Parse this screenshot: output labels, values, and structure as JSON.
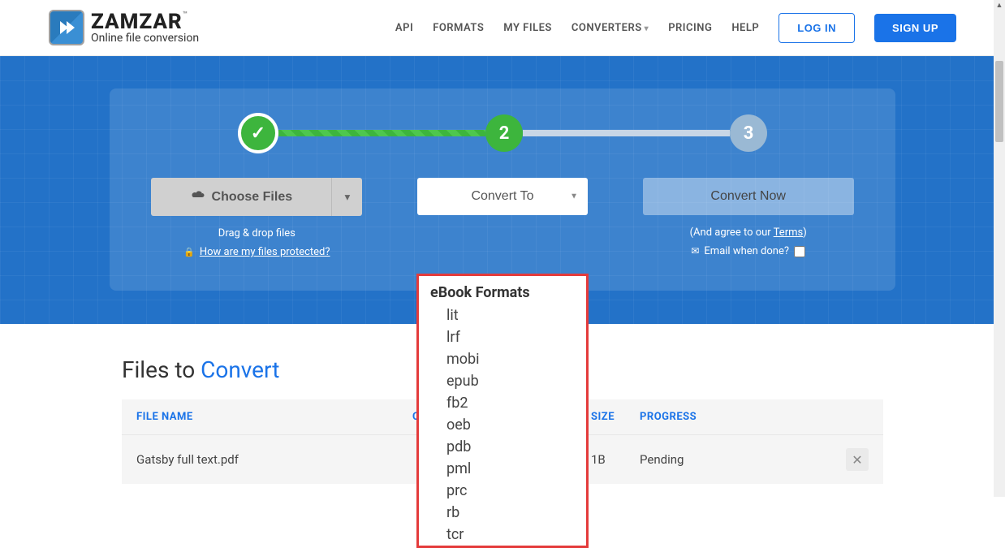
{
  "brand": {
    "name": "ZAMZAR",
    "tagline": "Online file conversion",
    "tm": "™"
  },
  "nav": {
    "api": "API",
    "formats": "FORMATS",
    "myfiles": "MY FILES",
    "converters": "CONVERTERS",
    "pricing": "PRICING",
    "help": "HELP",
    "login": "LOG IN",
    "signup": "SIGN UP"
  },
  "stepper": {
    "s1": "✓",
    "s2": "2",
    "s3": "3"
  },
  "actions": {
    "choose": "Choose Files",
    "dragdrop": "Drag & drop files",
    "protected": "How are my files protected?",
    "convert_to": "Convert To",
    "convert_now": "Convert Now",
    "agree_pre": "(And agree to our ",
    "terms": "Terms",
    "agree_post": ")",
    "email_done": "Email when done?"
  },
  "dropdown": {
    "header": "eBook Formats",
    "items": [
      "lit",
      "lrf",
      "mobi",
      "epub",
      "fb2",
      "oeb",
      "pdb",
      "pml",
      "prc",
      "rb",
      "tcr"
    ]
  },
  "files": {
    "title_a": "Files to ",
    "title_b": "Convert",
    "cols": {
      "name": "FILE NAME",
      "to": "CONVERT TO",
      "size": "SIZE",
      "progress": "PROGRESS"
    },
    "row": {
      "name": "Gatsby full text.pdf",
      "size_suffix": "1B",
      "progress": "Pending"
    }
  }
}
